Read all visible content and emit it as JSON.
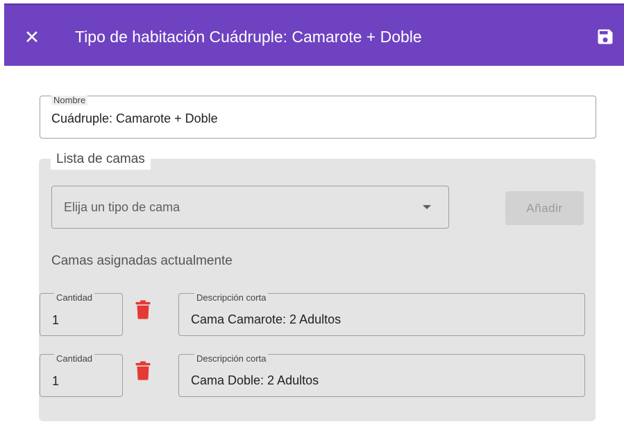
{
  "header": {
    "title": "Tipo de habitación Cuádruple: Camarote + Doble",
    "close_icon": "close-icon",
    "save_icon": "save-icon"
  },
  "nombre": {
    "label": "Nombre",
    "value": "Cuádruple: Camarote + Doble"
  },
  "camas": {
    "legend": "Lista de camas",
    "select_placeholder": "Elija un tipo de cama",
    "add_label": "Añadir",
    "assigned_label": "Camas asignadas actualmente",
    "items": [
      {
        "qty_label": "Cantidad",
        "qty_value": "1",
        "desc_label": "Descripción corta",
        "desc_value": "Cama Camarote: 2 Adultos"
      },
      {
        "qty_label": "Cantidad",
        "qty_value": "1",
        "desc_label": "Descripción corta",
        "desc_value": "Cama Doble: 2 Adultos"
      }
    ]
  },
  "colors": {
    "brand": "#6f42c1",
    "delete": "#e53935",
    "panel": "#e4e4e4",
    "disabled_button": "#d2d2d2"
  }
}
